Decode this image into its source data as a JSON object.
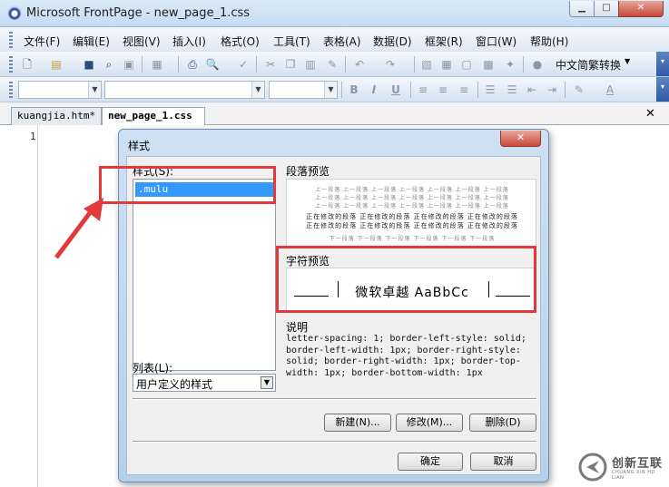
{
  "window": {
    "title": "Microsoft FrontPage - new_page_1.css"
  },
  "menu": [
    "文件(F)",
    "编辑(E)",
    "视图(V)",
    "插入(I)",
    "格式(O)",
    "工具(T)",
    "表格(A)",
    "数据(D)",
    "框架(R)",
    "窗口(W)",
    "帮助(H)"
  ],
  "toolbar": {
    "language_button": "中文简繁转换"
  },
  "tabs": [
    "kuangjia.htm*",
    "new_page_1.css"
  ],
  "editor": {
    "line_number": "1"
  },
  "dialog": {
    "title": "样式",
    "styles_label": "样式(S):",
    "styles_items": [
      ".mulu"
    ],
    "list_label": "列表(L):",
    "list_value": "用户定义的样式",
    "paragraph_preview_label": "段落预览",
    "paragraph_preview_prev_text": "上一段落 上一段落 上一段落 上一段落 上一段落 上一段落 上一段落",
    "paragraph_preview_text": "正在修改的段落 正在修改的段落 正在修改的段落 正在修改的段落",
    "paragraph_preview_next_text": "下一段落 下一段落 下一段落 下一段落 下一段落 下一段落",
    "char_preview_label": "字符预览",
    "char_preview_text": "微软卓越 AaBbCc",
    "description_label": "说明",
    "description_text": "letter-spacing: 1; border-left-style: solid; border-left-width: 1px; border-right-style: solid; border-right-width: 1px; border-top-width: 1px; border-bottom-width: 1px",
    "buttons": {
      "new": "新建(N)...",
      "modify": "修改(M)...",
      "delete": "删除(D)",
      "ok": "确定",
      "cancel": "取消"
    }
  },
  "watermark": {
    "brand": "创新互联",
    "sub": "CHUANG XIN HU LIAN"
  },
  "colors": {
    "annotation": "#e23a3a",
    "selection": "#3399ff"
  }
}
